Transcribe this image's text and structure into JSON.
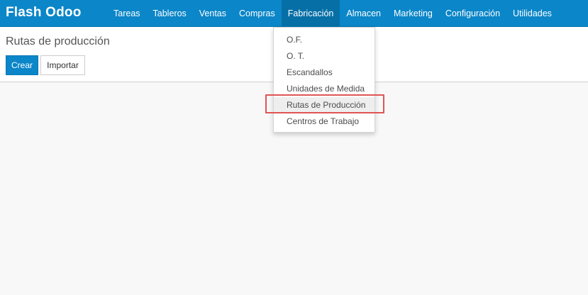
{
  "app": {
    "brand": "Flash Odoo"
  },
  "navbar": {
    "items": [
      {
        "label": "Tareas"
      },
      {
        "label": "Tableros"
      },
      {
        "label": "Ventas"
      },
      {
        "label": "Compras"
      },
      {
        "label": "Fabricación",
        "active": true
      },
      {
        "label": "Almacen"
      },
      {
        "label": "Marketing"
      },
      {
        "label": "Configuración"
      },
      {
        "label": "Utilidades"
      }
    ]
  },
  "control_panel": {
    "title": "Rutas de producción",
    "create_label": "Crear",
    "import_label": "Importar"
  },
  "dropdown": {
    "items": [
      {
        "label": "O.F."
      },
      {
        "label": "O. T."
      },
      {
        "label": "Escandallos"
      },
      {
        "label": "Unidades de Medida"
      },
      {
        "label": "Rutas de Producción",
        "highlighted": true
      },
      {
        "label": "Centros de Trabajo"
      }
    ]
  },
  "colors": {
    "navbar_bg": "#0b86c8",
    "navbar_active_bg": "#066fa6",
    "primary_button": "#0b86c8",
    "highlight_box": "#e05454",
    "content_bg": "#f8f8f8"
  }
}
